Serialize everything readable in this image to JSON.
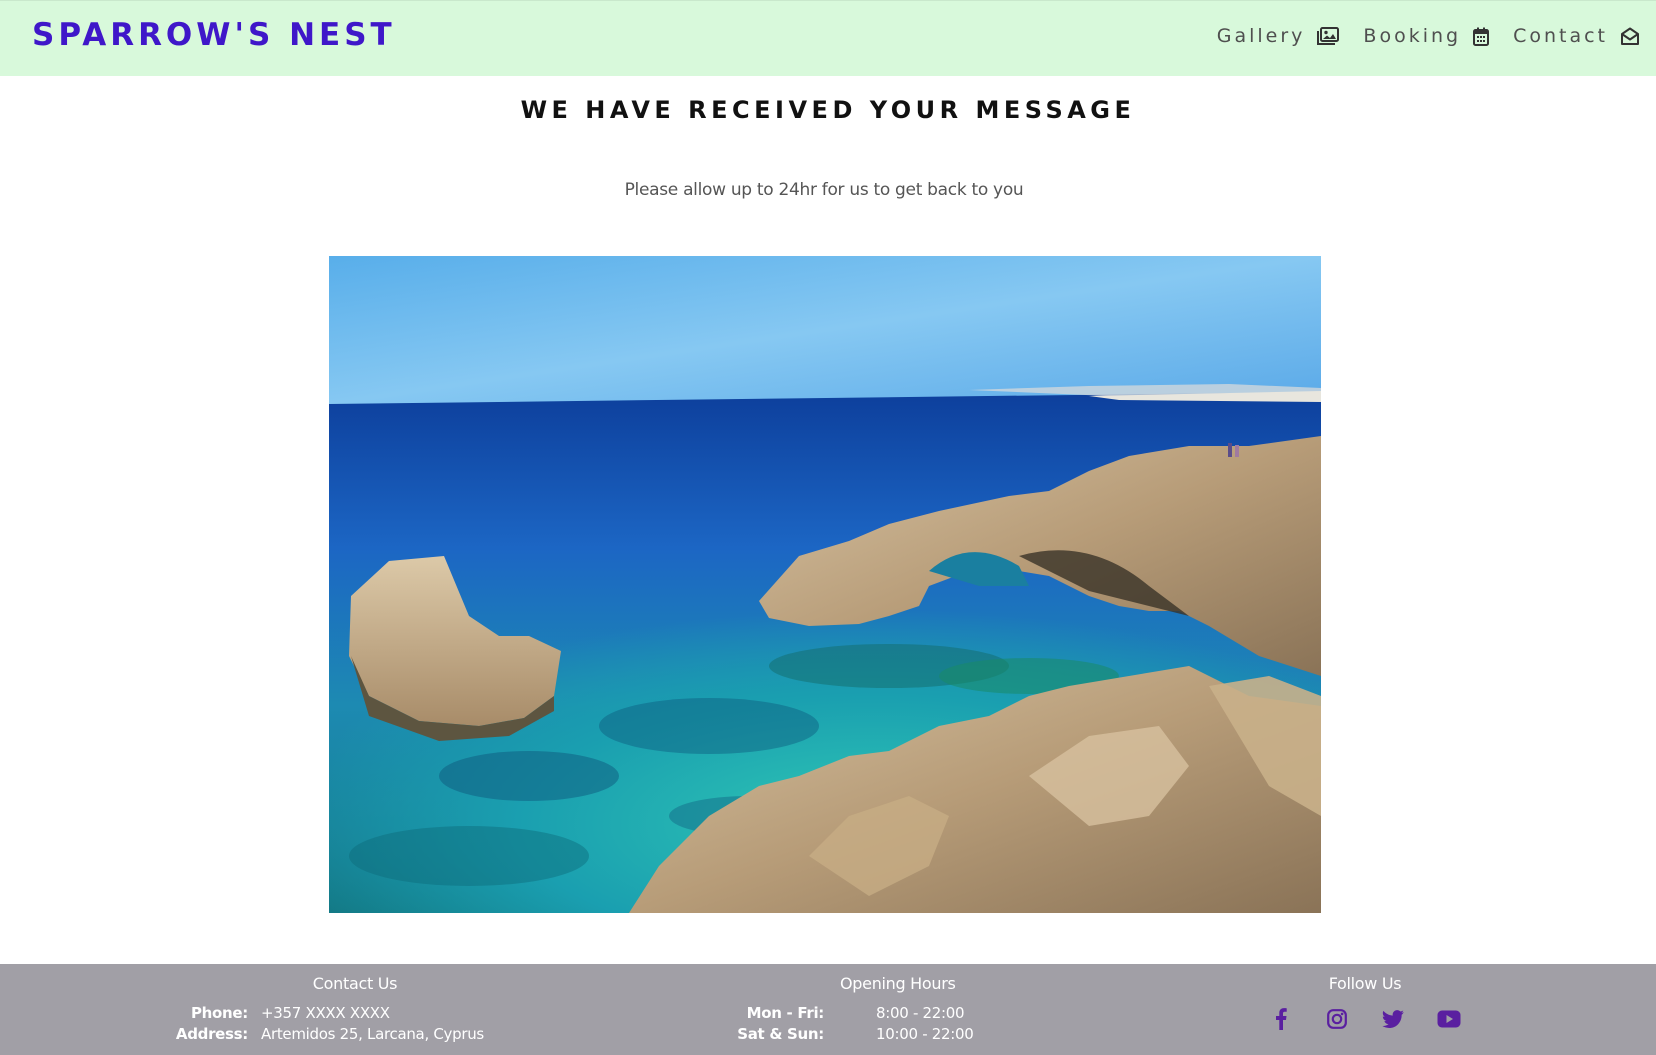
{
  "brand": "SPARROW'S NEST",
  "nav": {
    "gallery": "Gallery",
    "booking": "Booking",
    "contact": "Contact"
  },
  "main": {
    "heading": "WE HAVE RECEIVED YOUR MESSAGE",
    "subtext": "Please allow up to 24hr for us to get back to you"
  },
  "footer": {
    "contact": {
      "title": "Contact Us",
      "phone_label": "Phone:",
      "phone_value": "+357 XXXX XXXX",
      "address_label": "Address:",
      "address_value": "Artemidos 25, Larcana, Cyprus"
    },
    "hours": {
      "title": "Opening Hours",
      "weekday_label": "Mon - Fri:",
      "weekday_value": "8:00 - 22:00",
      "weekend_label": "Sat & Sun:",
      "weekend_value": "10:00 - 22:00"
    },
    "follow": {
      "title": "Follow Us",
      "icons": [
        "facebook-icon",
        "instagram-icon",
        "twitter-icon",
        "youtube-icon"
      ]
    }
  },
  "colors": {
    "brand": "#3f17c9",
    "navbar_bg": "#d8f9db",
    "footer_bg": "#a19fa6",
    "social_icon": "#5a1fa0"
  }
}
